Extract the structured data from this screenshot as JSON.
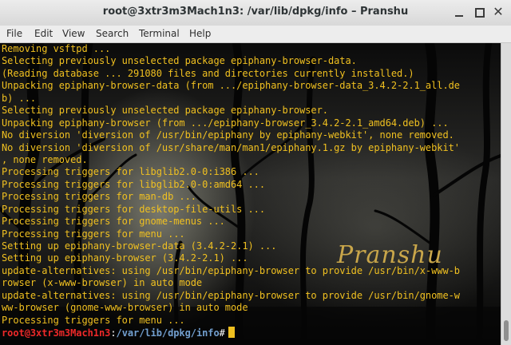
{
  "window": {
    "title": "root@3xtr3m3Mach1n3: /var/lib/dpkg/info – Pranshu"
  },
  "window_buttons": {
    "minimize": "minimize-icon",
    "maximize": "maximize-icon",
    "close_glyph": "✕"
  },
  "menu": {
    "file": "File",
    "edit": "Edit",
    "view": "View",
    "search": "Search",
    "terminal": "Terminal",
    "help": "Help"
  },
  "terminal": {
    "text_color": "#f0c020",
    "lines": [
      "Removing vsftpd ...",
      "Selecting previously unselected package epiphany-browser-data.",
      "(Reading database ... 291080 files and directories currently installed.)",
      "Unpacking epiphany-browser-data (from .../epiphany-browser-data_3.4.2-2.1_all.de",
      "b) ...",
      "Selecting previously unselected package epiphany-browser.",
      "Unpacking epiphany-browser (from .../epiphany-browser_3.4.2-2.1_amd64.deb) ...",
      "No diversion 'diversion of /usr/bin/epiphany by epiphany-webkit', none removed.",
      "No diversion 'diversion of /usr/share/man/man1/epiphany.1.gz by epiphany-webkit'",
      ", none removed.",
      "Processing triggers for libglib2.0-0:i386 ...",
      "Processing triggers for libglib2.0-0:amd64 ...",
      "Processing triggers for man-db ...",
      "Processing triggers for desktop-file-utils ...",
      "Processing triggers for gnome-menus ...",
      "Processing triggers for menu ...",
      "Setting up epiphany-browser-data (3.4.2-2.1) ...",
      "Setting up epiphany-browser (3.4.2-2.1) ...",
      "update-alternatives: using /usr/bin/epiphany-browser to provide /usr/bin/x-www-b",
      "rowser (x-www-browser) in auto mode",
      "update-alternatives: using /usr/bin/epiphany-browser to provide /usr/bin/gnome-w",
      "ww-browser (gnome-www-browser) in auto mode",
      "Processing triggers for menu ..."
    ],
    "prompt": {
      "user_host": "root@3xtr3m3Mach1n3",
      "separator": ":",
      "path": "/var/lib/dpkg/info",
      "symbol": "#"
    },
    "watermark": "Pranshu"
  },
  "scrollbar": {
    "position": 0.97
  }
}
